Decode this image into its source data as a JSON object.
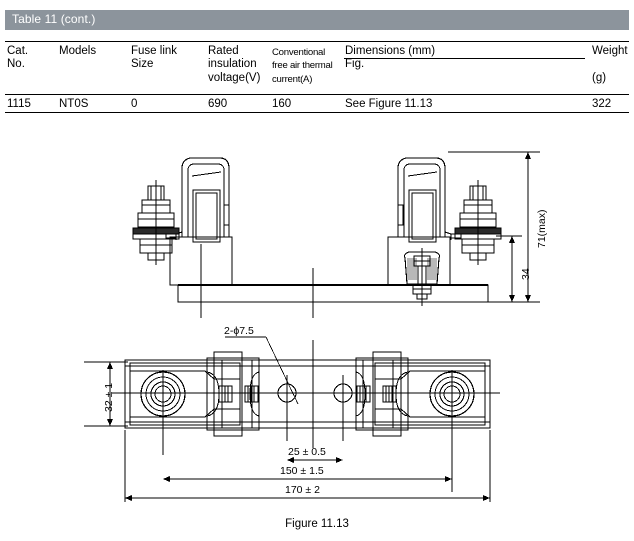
{
  "table": {
    "title": "Table 11 (cont.)",
    "headers": [
      "Cat.\nNo.",
      "Models",
      "Fuse link\nSize",
      "Rated\ninsulation\nvoltage(V)",
      "Conventional\nfree air thermal\ncurrent(A)",
      "Dimensions (mm)\nFig.",
      "Weight\n\n(g)"
    ],
    "row": {
      "cat_no": "1115",
      "models": "NT0S",
      "fuse_link_size": "0",
      "rated_insulation_voltage": "690",
      "conventional_free_air_thermal_current": "160",
      "dimensions_fig": "See Figure 11.13",
      "weight": "322"
    }
  },
  "figure": {
    "caption": "Figure 11.13",
    "dimensions": {
      "height_max": "71(max)",
      "height_mid": "34",
      "width_body": "32 ± 1",
      "hole_spec": "2-ϕ7.5",
      "hole_pitch_small": "25 ± 0.5",
      "hole_pitch_large": "150 ± 1.5",
      "overall_length": "170 ± 2"
    }
  },
  "colors": {
    "header_bar": "#8c949c",
    "header_text": "#ffffff",
    "line": "#000000",
    "background": "#ffffff"
  }
}
